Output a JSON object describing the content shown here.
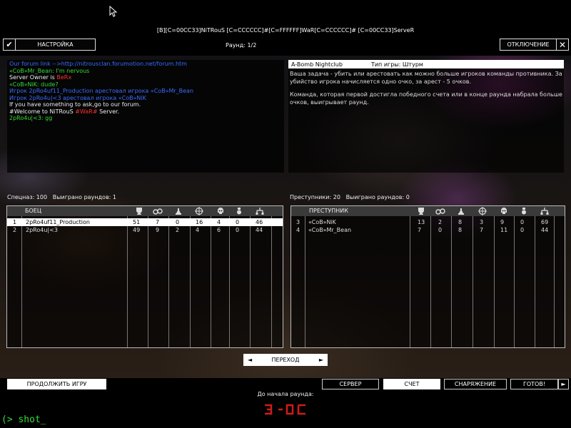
{
  "server_title": "[B][C=00CC33]NiTRouS [C=CCCCCC]#[C=FFFFFF]WaR[C=CCCCCC]# [C=00CC33]ServeR",
  "top": {
    "settings_label": "НАСТРОЙКА",
    "round_label": "Раунд: 1/2",
    "disconnect_label": "ОТКЛЮЧЕНИЕ"
  },
  "chat": [
    {
      "segments": [
        {
          "text": "Our forum link -->http://nitrousclan.forumotion.net/forum.htm",
          "color": "blue"
        }
      ]
    },
    {
      "segments": [
        {
          "text": "«CoB»Mr_Bean: I'm nervous",
          "color": "green"
        }
      ]
    },
    {
      "segments": [
        {
          "text": "Server Owner is ",
          "color": "white"
        },
        {
          "text": "BeRx",
          "color": "red"
        }
      ]
    },
    {
      "segments": [
        {
          "text": "«CoB»NiK: dude?",
          "color": "green"
        }
      ]
    },
    {
      "segments": [
        {
          "text": "Игрок 2pRo4uf11_Production арестовал игрока «CoB»Mr_Bean",
          "color": "blue"
        }
      ]
    },
    {
      "segments": [
        {
          "text": "Игрок 2pRo4u|<3 арестовал игрока «CoB»NiK",
          "color": "blue"
        }
      ]
    },
    {
      "segments": [
        {
          "text": "If you have something to ask,go to our forum.",
          "color": "white"
        }
      ]
    },
    {
      "segments": [
        {
          "text": "#Welcome to NiTRouS ",
          "color": "white"
        },
        {
          "text": "#WaR#",
          "color": "red"
        },
        {
          "text": " Server.",
          "color": "white"
        }
      ]
    },
    {
      "segments": [
        {
          "text": "2pRo4u|<3: gg",
          "color": "green"
        }
      ]
    }
  ],
  "map_info": {
    "map_name": "A-Bomb Nightclub",
    "game_type": "Тип игры: Штурм",
    "description_1": "Ваша задача - убить или арестовать как можно больше игроков команды противника. За убийство игрока начисляется одно очко, за арест - 5 очков.",
    "description_2": "Команда, которая первой достигла победного счета или в конце раунда набрала больше очков, выигрывает раунд."
  },
  "teams": {
    "left": {
      "summary_score": "Спецназ: 100",
      "summary_rounds": "Выиграно раундов: 1",
      "header_name": "БОЕЦ",
      "players": [
        {
          "num": "1",
          "name": "2pRo4uf11_Production",
          "score": "51",
          "s2": "7",
          "s3": "0",
          "s4": "16",
          "s5": "4",
          "s6": "0",
          "ping": "46",
          "selected": true
        },
        {
          "num": "2",
          "name": "2pRo4u|<3",
          "score": "49",
          "s2": "9",
          "s3": "2",
          "s4": "4",
          "s5": "6",
          "s6": "0",
          "ping": "44",
          "selected": false
        }
      ]
    },
    "right": {
      "summary_score": "Преступники: 20",
      "summary_rounds": "Выиграно раундов: 0",
      "header_name": "ПРЕСТУПНИК",
      "players": [
        {
          "num": "3",
          "name": "«CoB»NiK",
          "score": "13",
          "s2": "2",
          "s3": "8",
          "s4": "3",
          "s5": "9",
          "s6": "0",
          "ping": "69",
          "selected": false
        },
        {
          "num": "4",
          "name": "«CoB»Mr_Bean",
          "score": "7",
          "s2": "0",
          "s3": "8",
          "s4": "7",
          "s5": "11",
          "s6": "0",
          "ping": "44",
          "selected": false
        }
      ]
    }
  },
  "column_icons": [
    "trophy-icon",
    "handcuffs-icon",
    "chess-piece-icon",
    "crosshair-icon",
    "skull-icon",
    "medal-icon",
    "network-icon"
  ],
  "footer": {
    "next_label": "ПЕРЕХОД",
    "prev_arrow": "◄",
    "next_arrow": "►",
    "continue_label": "ПРОДОЛЖИТЬ ИГРУ",
    "server_label": "СЕРВЕР",
    "score_label": "СЧЕТ",
    "equipment_label": "СНАРЯЖЕНИЕ",
    "ready_label": "ГОТОВ!",
    "ready_arrow": "►",
    "start_label": "До начала раунда:",
    "console_text": "(> shot_"
  },
  "colors": {
    "chat_blue": "#3a6cff",
    "chat_green": "#33dd33",
    "chat_red": "#ff3030",
    "chat_white": "#eeeeee",
    "timer_red": "#d11a1a"
  }
}
